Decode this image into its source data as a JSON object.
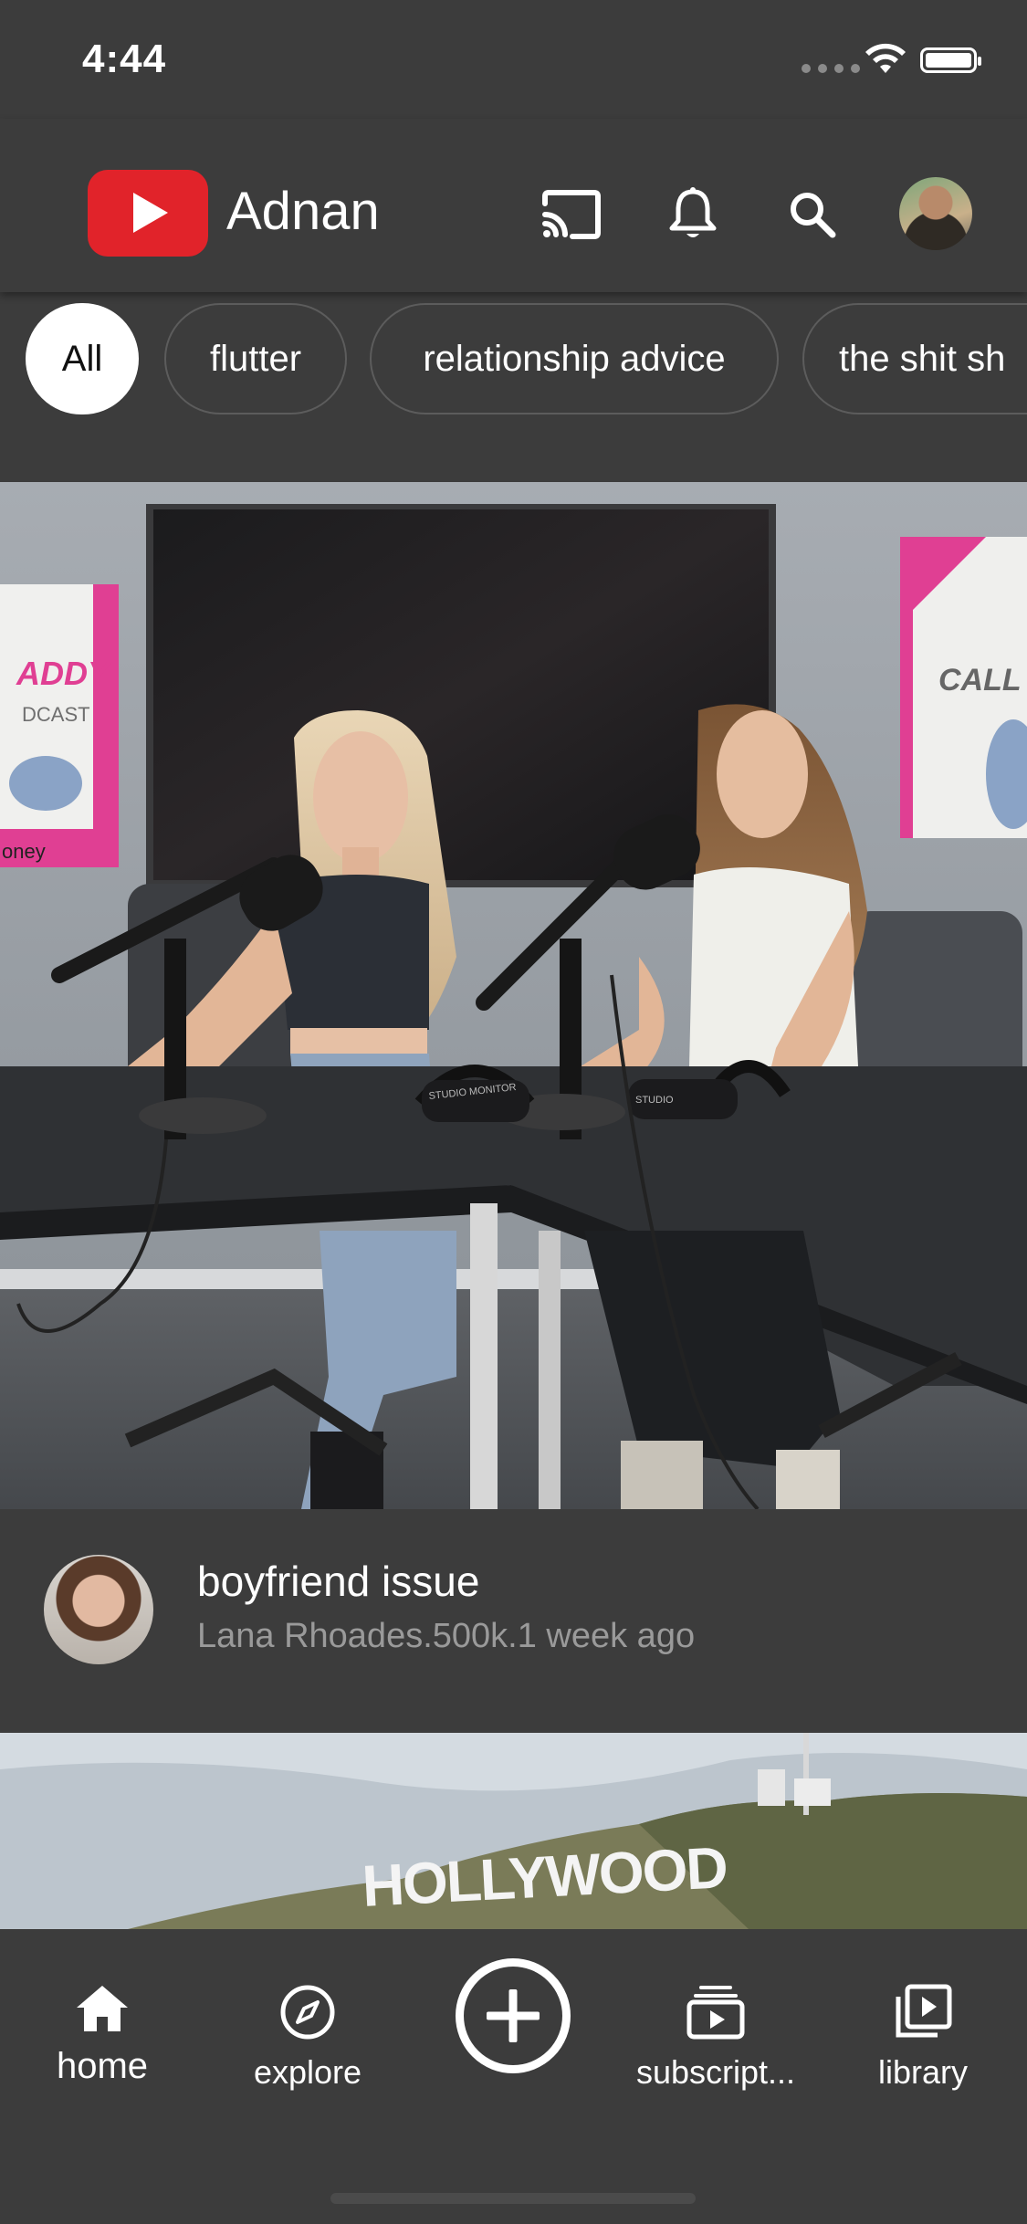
{
  "status_bar": {
    "time": "4:44"
  },
  "app_bar": {
    "brand": "Adnan",
    "icons": [
      "cast-icon",
      "bell-icon",
      "search-icon",
      "avatar"
    ]
  },
  "chips": [
    "All",
    "flutter",
    "relationship advice",
    "the shit sh"
  ],
  "feed": [
    {
      "title": "boyfriend issue",
      "subtitle": "Lana Rhoades.500k.1 week ago",
      "thumbnail_text": {
        "left_poster": [
          "ADDY",
          "DCAST",
          "oney"
        ],
        "right_poster": "CALL H",
        "headphone_left": "STUDIO MONITOR",
        "headphone_right": "STUDIO"
      }
    },
    {
      "thumbnail_text": {
        "sign": "HOLLYWOOD"
      }
    }
  ],
  "bottom_nav": {
    "home": "home",
    "explore": "explore",
    "subscriptions": "subscript...",
    "library": "library"
  },
  "colors": {
    "background": "#3c3c3c",
    "brand_red": "#e1232a",
    "chip_border": "#5c5c5c",
    "subtext": "#9a9a9a"
  }
}
